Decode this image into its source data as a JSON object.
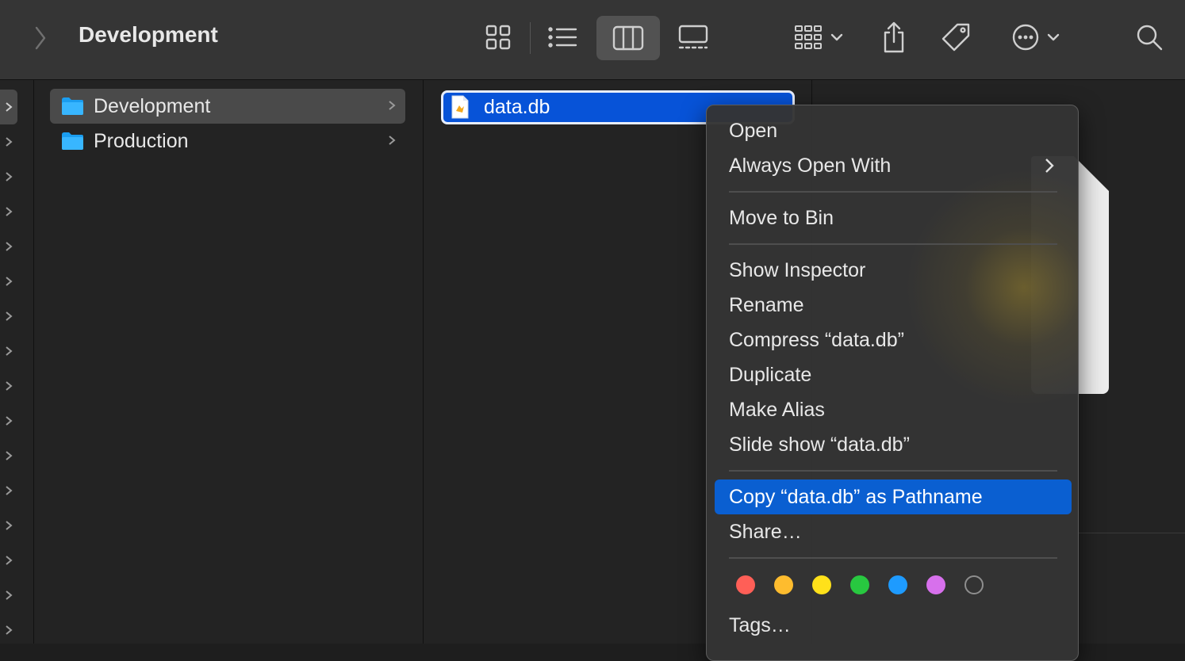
{
  "window": {
    "title": "Development"
  },
  "toolbar": {
    "back_icon": "chevron-left-icon",
    "views": [
      "icon-view",
      "list-view",
      "column-view",
      "gallery-view"
    ],
    "selected_view": "column-view",
    "group_icon": "group-grid-icon",
    "share_icon": "share-icon",
    "tag_icon": "tag-icon",
    "more_icon": "ellipsis-circle-icon",
    "search_icon": "search-icon"
  },
  "column1": {
    "items": [
      {
        "label": "Development",
        "selected": true
      },
      {
        "label": "Production",
        "selected": false
      }
    ]
  },
  "column2": {
    "items": [
      {
        "label": "data.db",
        "selected": true
      }
    ]
  },
  "context_menu": {
    "items": [
      {
        "label": "Open"
      },
      {
        "label": "Always Open With",
        "submenu": true
      },
      {
        "label": "Move to Bin"
      },
      {
        "label": "Show Inspector"
      },
      {
        "label": "Rename"
      },
      {
        "label": "Compress “data.db”"
      },
      {
        "label": "Duplicate"
      },
      {
        "label": "Make Alias"
      },
      {
        "label": "Slide show “data.db”"
      },
      {
        "label": "Copy “data.db” as Pathname",
        "highlighted": true
      },
      {
        "label": "Share…"
      },
      {
        "label": "Tags…"
      }
    ],
    "tag_colors": [
      {
        "name": "red",
        "color": "#ff5f57"
      },
      {
        "name": "orange",
        "color": "#febc2e"
      },
      {
        "name": "yellow",
        "color": "#ffe11a"
      },
      {
        "name": "green",
        "color": "#28c840"
      },
      {
        "name": "blue",
        "color": "#1e9bff"
      },
      {
        "name": "purple",
        "color": "#d770ec"
      },
      {
        "name": "gray",
        "color": "#8e8e8e"
      }
    ]
  },
  "colors": {
    "accent": "#0a5fd1",
    "folder": "#1a9df0",
    "selection": "#0753d8"
  }
}
